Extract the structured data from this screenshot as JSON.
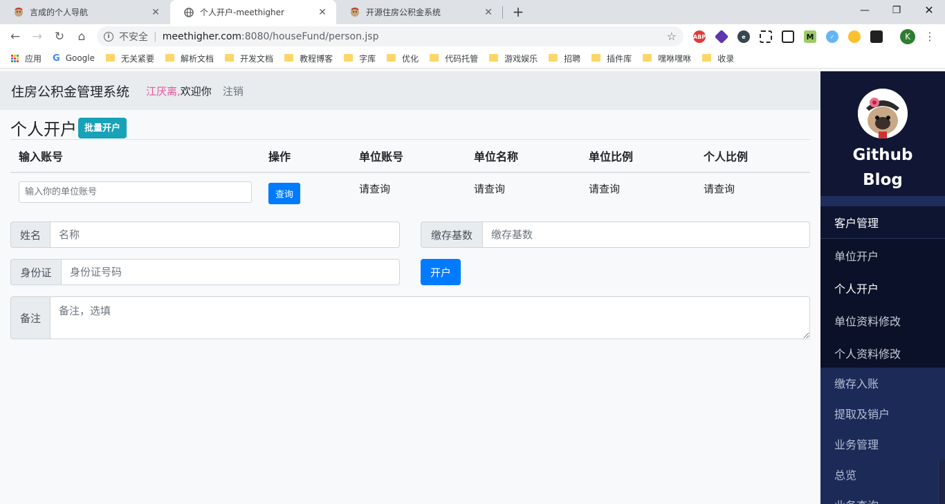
{
  "browser": {
    "tabs": [
      {
        "title": "言成的个人导航",
        "active": false
      },
      {
        "title": "个人开户-meethigher",
        "active": true
      },
      {
        "title": "开源住房公积金系统",
        "active": false
      }
    ],
    "address": {
      "security": "不安全",
      "host": "meethigher.com",
      "path": ":8080/houseFund/person.jsp"
    },
    "profile_initial": "K",
    "extensions": [
      "ABP",
      "",
      "e",
      "",
      "",
      "M",
      "",
      "",
      ""
    ],
    "bookmarks": [
      "应用",
      "Google",
      "无关紧要",
      "解析文档",
      "开发文档",
      "教程博客",
      "字库",
      "优化",
      "代码托管",
      "游戏娱乐",
      "招聘",
      "插件库",
      "嘿咻嘿咻",
      "收录"
    ]
  },
  "header": {
    "brand": "住房公积金管理系统",
    "user": "江厌离,",
    "welcome": "欢迎你",
    "logout": "注销"
  },
  "page": {
    "title": "个人开户",
    "batch_button": "批量开户"
  },
  "table": {
    "headers": [
      "输入账号",
      "操作",
      "单位账号",
      "单位名称",
      "单位比例",
      "个人比例"
    ],
    "input_placeholder": "输入你的单位账号",
    "query_button": "查询",
    "placeholder_cells": [
      "请查询",
      "请查询",
      "请查询",
      "请查询"
    ]
  },
  "form": {
    "name": {
      "label": "姓名",
      "placeholder": "名称"
    },
    "base": {
      "label": "缴存基数",
      "placeholder": "缴存基数"
    },
    "idcard": {
      "label": "身份证",
      "placeholder": "身份证号码"
    },
    "remark": {
      "label": "备注",
      "placeholder": "备注，选填"
    },
    "submit": "开户"
  },
  "sidebar": {
    "title": "Github Blog",
    "section": "客户管理",
    "sub_items": [
      "单位开户",
      "个人开户",
      "单位资料修改",
      "个人资料修改"
    ],
    "main_items": [
      "缴存入账",
      "提取及销户",
      "业务管理",
      "总览",
      "业务查询"
    ]
  }
}
